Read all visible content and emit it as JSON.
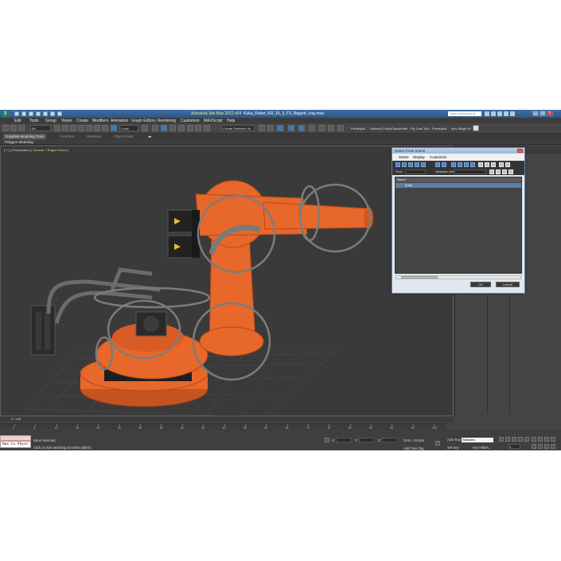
{
  "window": {
    "title": "Autodesk 3ds Max  2012 x64",
    "file_name": "Kuka_Robot_KR_16_3_F3_Rigged_vray.max",
    "search_placeholder": "Type a keyword or phrase"
  },
  "menubar": [
    "Edit",
    "Tools",
    "Group",
    "Views",
    "Create",
    "Modifiers",
    "Animation",
    "Graph Editors",
    "Rendering",
    "Customize",
    "MAXScript",
    "Help"
  ],
  "toolbar": {
    "selection_filter": "All",
    "coord_system": "Local",
    "named_selection": "Create Selection Se",
    "plugins": [
      "Pixelsquid",
      "Delivery Check",
      "CheckMate",
      "Ply Cam Tool",
      "Pixelsquid",
      "lens Stage vS"
    ]
  },
  "ribbon": {
    "tabs": [
      "Graphite Modeling Tools",
      "Freeform",
      "Selection",
      "Object Paint"
    ],
    "active_tab": "Graphite Modeling Tools",
    "panel_label": "Polygon Modeling"
  },
  "viewport": {
    "label_prefix": "[ + ] [ Perspective ] [ ",
    "label_mode": "Smooth + Edged Faces",
    "label_suffix": " ]",
    "model_color": "#e8672a"
  },
  "dialog": {
    "title": "Select From Scene",
    "close_glyph": "x",
    "menu": [
      "Select",
      "Display",
      "Customize"
    ],
    "find_label": "Find:",
    "selection_set_label": "Selection Set:",
    "column_header": "Name",
    "rows": [
      "Kuka"
    ],
    "ok_label": "OK",
    "cancel_label": "Cancel"
  },
  "timeline": {
    "frame_label": "0 / 100",
    "ticks": [
      "0",
      "5",
      "10",
      "15",
      "20",
      "25",
      "30",
      "35",
      "40",
      "45",
      "50",
      "55",
      "60",
      "65",
      "70",
      "75",
      "80",
      "85",
      "90",
      "95",
      "100"
    ]
  },
  "status": {
    "maxscript_text": "Max to Physc",
    "selection_status": "None Selected",
    "prompt": "Click or click-and-drag to select objects",
    "x_label": "X:",
    "y_label": "Y:",
    "z_label": "Z:",
    "grid": "Grid = 10,0cm",
    "add_time_tag": "Add Time Tag",
    "auto_key": "Auto Key",
    "set_key": "Set Key",
    "key_filters": "Key Filters...",
    "selected_dropdown": "Selected",
    "frame_value": "0"
  }
}
